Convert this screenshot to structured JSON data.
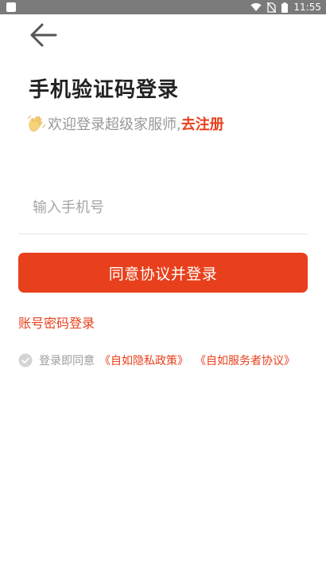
{
  "status_bar": {
    "time": "11:55",
    "icons": [
      "wifi-icon",
      "no-sim-icon",
      "battery-icon"
    ]
  },
  "header": {
    "back_icon": "back-arrow-icon"
  },
  "login": {
    "title": "手机验证码登录",
    "welcome_text": "欢迎登录超级家服师,",
    "register_link": "去注册",
    "phone_placeholder": "输入手机号",
    "phone_value": "",
    "submit_label": "同意协议并登录",
    "password_login_link": "账号密码登录"
  },
  "agreement": {
    "prefix": "登录即同意",
    "privacy_policy": "《自如隐私政策》",
    "service_agreement": "《自如服务者协议》",
    "checked": false
  },
  "colors": {
    "accent": "#e8401c",
    "status_bar": "#7a7a7a",
    "muted_text": "#999999",
    "divider": "#e6e6e6"
  }
}
